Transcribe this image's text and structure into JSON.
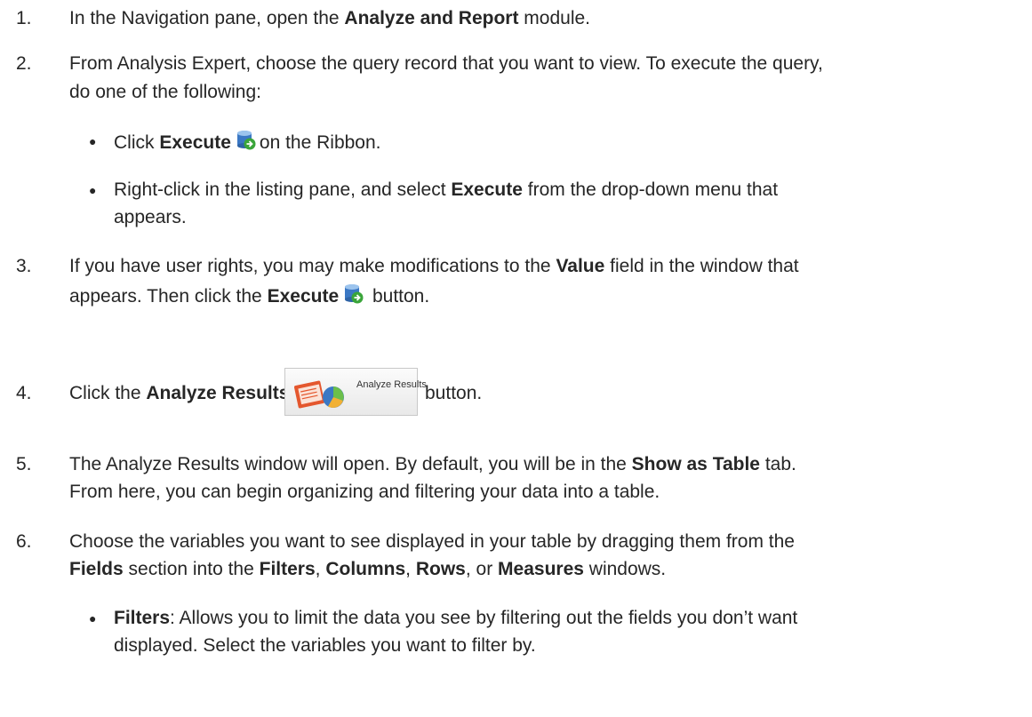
{
  "steps": [
    {
      "num": "1.",
      "pre": "In the Navigation pane, open the ",
      "bold": "Analyze and Report",
      "post": " module."
    },
    {
      "num": "2.",
      "line1": "From Analysis Expert, choose the query record that you want to view. To execute the query,",
      "line2": "do one of the following:"
    },
    {
      "num": "3.",
      "line1_pre": "If you have user rights, you may make modifications to the ",
      "line1_bold": "Value",
      "line1_post": " field in the window that",
      "line2_pre": "appears. Then click the ",
      "line2_bold": "Execute",
      "line2_post": " button."
    },
    {
      "num": "4.",
      "pre": "Click the ",
      "bold": "Analyze Results",
      "post": "button."
    },
    {
      "num": "5.",
      "line1_pre": "The Analyze Results window will open. By default, you will be in the ",
      "line1_bold": "Show as Table",
      "line1_post": " tab.",
      "line2": "From here, you can begin organizing and filtering your data into a table."
    },
    {
      "num": "6.",
      "line1": "Choose the variables you want to see displayed in your table by dragging them from the",
      "line2_b1": "Fields",
      "line2_t1": " section into the ",
      "line2_b2": "Filters",
      "line2_t2": ", ",
      "line2_b3": "Columns",
      "line2_t3": ", ",
      "line2_b4": "Rows",
      "line2_t4": ", or ",
      "line2_b5": "Measures",
      "line2_t5": " windows."
    }
  ],
  "bullets_step2": [
    {
      "pre": "Click ",
      "bold": "Execute",
      "post": "on the Ribbon."
    },
    {
      "line1_pre": "Right-click in the listing pane, and select ",
      "line1_bold": "Execute",
      "line1_post": " from the drop-down menu that",
      "line2": "appears."
    }
  ],
  "bullets_step6": [
    {
      "bold": "Filters",
      "line1": ": Allows you to limit the data you see by filtering out the fields you don’t want",
      "line2": "displayed. Select the variables you want to filter by."
    }
  ],
  "analyze_button": {
    "label": "Analyze Results"
  },
  "icons": {
    "execute": "database-execute-icon",
    "analyze": "analyze-results-icon"
  },
  "colors": {
    "text": "#262626",
    "execute_green": "#3aa53a",
    "execute_db": "#3b78c4"
  }
}
